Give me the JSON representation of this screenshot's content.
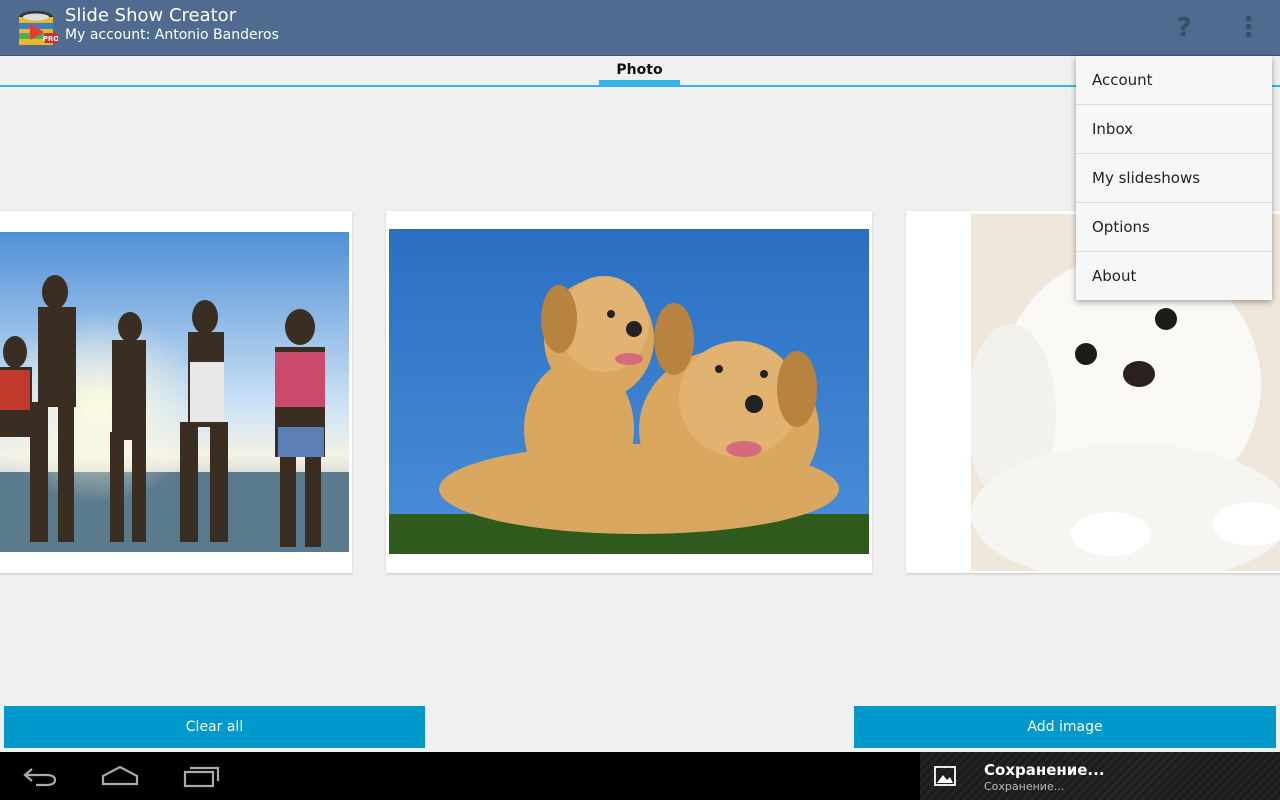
{
  "app": {
    "title": "Slide Show Creator",
    "subtitle": "My account: Antonio Banderos",
    "icon_badge": "PRO"
  },
  "actionbar": {
    "help_icon": "question-mark-icon",
    "overflow_icon": "overflow-menu-icon",
    "help_glyph": "?"
  },
  "tabs": [
    {
      "label": "Photo",
      "selected": true
    }
  ],
  "photos": [
    {
      "name": "photo-people-dancing",
      "subject": "people-dancing"
    },
    {
      "name": "photo-labrador-dogs",
      "subject": "labrador-dogs"
    },
    {
      "name": "photo-white-puppy",
      "subject": "white-puppy"
    }
  ],
  "buttons": {
    "clear_all": "Clear all",
    "add_image": "Add image"
  },
  "overflow_menu": {
    "items": [
      "Account",
      "Inbox",
      "My slideshows",
      "Options",
      "About"
    ]
  },
  "notification": {
    "title": "Сохранение...",
    "text": "Сохранение...",
    "icon": "image-icon"
  },
  "navbar": {
    "back_icon": "back-icon",
    "home_icon": "home-icon",
    "recents_icon": "recent-apps-icon"
  },
  "colors": {
    "actionbar": "#4f6b8f",
    "accent": "#33b5e5",
    "button": "#0099cc",
    "background": "#f0f0f0"
  }
}
